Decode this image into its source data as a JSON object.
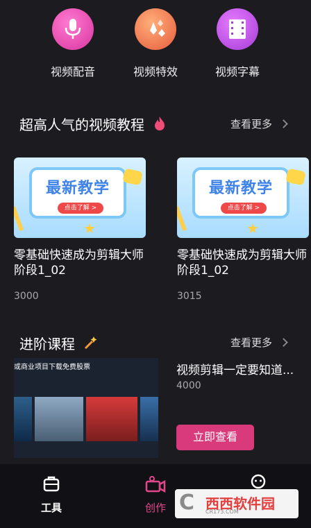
{
  "tools": [
    {
      "label": "视频配音",
      "icon": "microphone-icon"
    },
    {
      "label": "视频特效",
      "icon": "sparkle-effects-icon"
    },
    {
      "label": "视频字幕",
      "icon": "film-subtitle-icon"
    }
  ],
  "popular": {
    "title": "超高人气的视频教程",
    "more": "查看更多",
    "cards": [
      {
        "thumb_text": "最新教学",
        "thumb_button": "点击了解 >",
        "title": "零基础快速成为剪辑大师 阶段1_02",
        "count": "3000"
      },
      {
        "thumb_text": "最新教学",
        "thumb_button": "点击了解 >",
        "title": "零基础快速成为剪辑大师 阶段1_02",
        "count": "3015"
      }
    ]
  },
  "advanced": {
    "title": "进阶课程",
    "more": "查看更多",
    "thumb_header": "或商业项目下载免费股票",
    "course_title": "视频剪辑一定要知道...",
    "count": "4000",
    "button": "立即查看"
  },
  "bottom_nav": [
    {
      "label": "工具",
      "icon": "toolbox-icon"
    },
    {
      "label": "创作",
      "icon": "video-camera-icon"
    },
    {
      "label": "",
      "icon": "profile-icon"
    }
  ],
  "watermark": {
    "logo": "C",
    "main": "西西软件园",
    "sub": "CR173.COM"
  },
  "colors": {
    "background": "#1c1b20",
    "accent": "#d83a7c",
    "fire": "#ef4c7a"
  }
}
